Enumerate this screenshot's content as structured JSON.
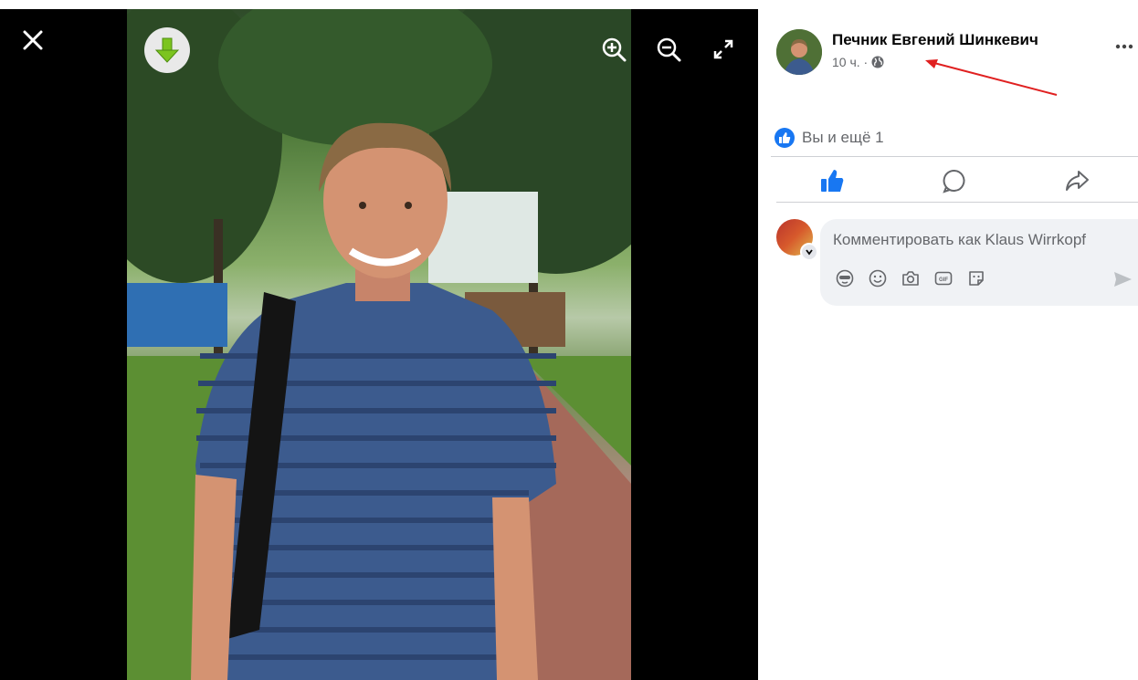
{
  "post": {
    "author": "Печник Евгений Шинкевич",
    "time": "10 ч. ·",
    "privacy_icon": "globe-icon"
  },
  "reactions": {
    "text": "Вы и ещё 1",
    "icon": "like-icon"
  },
  "actions": [
    {
      "icon": "like-icon"
    },
    {
      "icon": "comment-icon"
    },
    {
      "icon": "share-icon"
    }
  ],
  "comment": {
    "placeholder": "Комментировать как Klaus Wirrkopf",
    "tools": [
      "avatar-sticker-icon",
      "emoji-icon",
      "camera-icon",
      "gif-icon",
      "sticker-icon"
    ],
    "send_icon": "send-icon"
  },
  "viewer": {
    "close_icon": "close-icon",
    "download_icon": "download-arrow-icon",
    "zoom_in_icon": "zoom-in-icon",
    "zoom_out_icon": "zoom-out-icon",
    "fullscreen_icon": "fullscreen-icon"
  },
  "colors": {
    "accent": "#1877f2",
    "annotation_arrow": "#e02020",
    "download_green": "#7cc41f"
  }
}
